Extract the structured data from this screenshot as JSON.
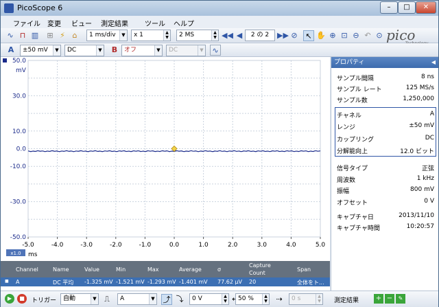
{
  "window": {
    "title": "PicoScope 6",
    "minimize": "–",
    "maximize": "□",
    "close": "✕"
  },
  "menu": [
    "ファイル",
    "変更",
    "ビュー",
    "測定結果",
    "ツール",
    "ヘルプ"
  ],
  "toolbar": {
    "timebase": "1 ms/div",
    "zoom": "x 1",
    "samples": "2 MS",
    "capture_page": "2",
    "capture_of": "の",
    "capture_total": "2",
    "logo": "pico",
    "logo_sub": "Technology"
  },
  "channel_bar": {
    "a_label": "A",
    "a_range": "±50 mV",
    "a_coupling": "DC",
    "b_label": "B",
    "b_range": "オフ",
    "b_coupling": "DC"
  },
  "plot": {
    "y_unit": "mV",
    "y_top_value": "50.0",
    "y_labels": [
      "50.0",
      "40.0",
      "30.0",
      "20.0",
      "10.0",
      "0.0",
      "-10.0",
      "-20.0",
      "-30.0",
      "-40.0",
      "-50.0"
    ],
    "x_labels": [
      "-5.0",
      "-4.0",
      "-3.0",
      "-2.0",
      "-1.0",
      "0.0",
      "1.0",
      "2.0",
      "3.0",
      "4.0",
      "5.0"
    ],
    "x_unit": "ms",
    "zoom_badge": "x1.0",
    "trace_color": "#1a2a8a",
    "trigger_color": "#f2d34a",
    "axis_color": "#1a2a8a"
  },
  "properties": {
    "header": "プロパティ",
    "rows_top": [
      {
        "label": "サンプル間隔",
        "value": "8 ns"
      },
      {
        "label": "サンプル レート",
        "value": "125 MS/s"
      },
      {
        "label": "サンプル数",
        "value": "1,250,000"
      }
    ],
    "rows_channel": [
      {
        "label": "チャネル",
        "value": "A"
      },
      {
        "label": "レンジ",
        "value": "±50 mV"
      },
      {
        "label": "カップリング",
        "value": "DC"
      },
      {
        "label": "分解能向上",
        "value": "12.0 ビット"
      }
    ],
    "rows_signal": [
      {
        "label": "信号タイプ",
        "value": "正弦"
      },
      {
        "label": "周波数",
        "value": "1 kHz"
      },
      {
        "label": "振幅",
        "value": "800 mV"
      },
      {
        "label": "オフセット",
        "value": "0 V"
      }
    ],
    "rows_capture": [
      {
        "label": "キャプチャ日",
        "value": "2013/11/10"
      },
      {
        "label": "キャプチャ時間",
        "value": "10:20:57"
      }
    ]
  },
  "measurements": {
    "headers": [
      "Channel",
      "Name",
      "Value",
      "Min",
      "Max",
      "Average",
      "σ",
      "Capture",
      "Count",
      "Span"
    ],
    "row": [
      "A",
      "DC 平均",
      "-1.325 mV",
      "-1.521 mV",
      "-1.293 mV",
      "-1.401 mV",
      "77.62 µV",
      "20",
      "全体をト..."
    ]
  },
  "bottom": {
    "trigger_label": "トリガー",
    "trigger_mode": "自動",
    "trigger_channel": "A",
    "threshold": "0 V",
    "position": "50 %",
    "delay": "0 s",
    "measure_label": "測定結果"
  }
}
